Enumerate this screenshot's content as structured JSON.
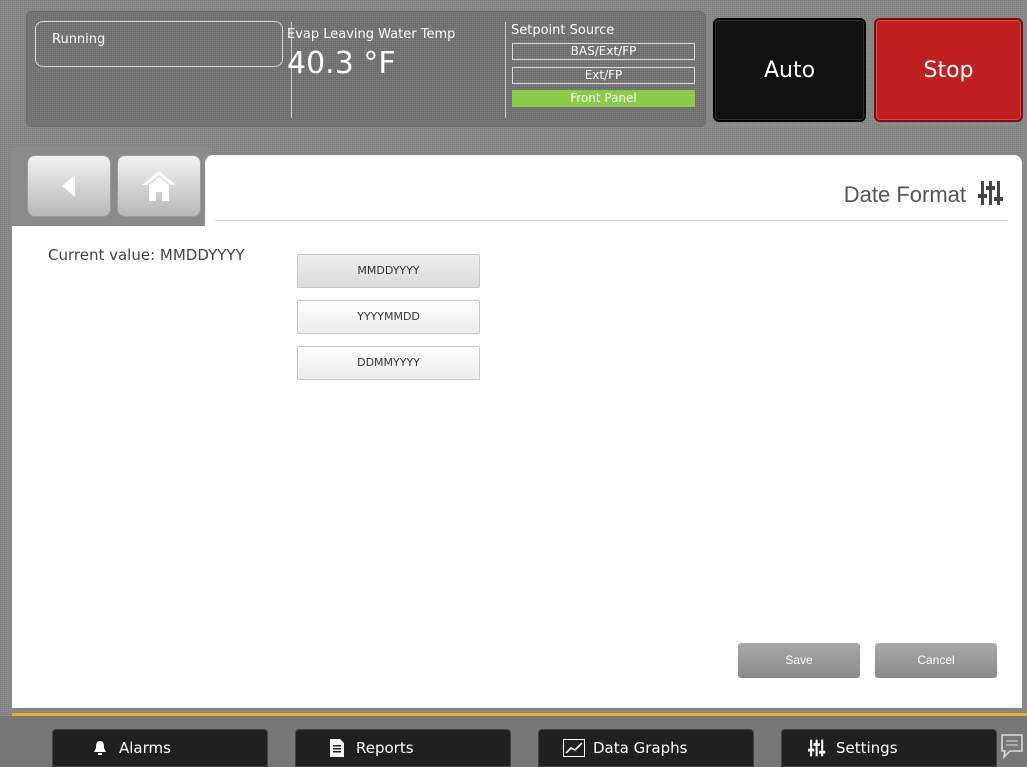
{
  "status": {
    "running": "Running",
    "evap_label": "Evap Leaving Water Temp",
    "evap_value": "40.3 °F",
    "setpoint_label": "Setpoint Source",
    "setpoint_options": [
      "BAS/Ext/FP",
      "Ext/FP",
      "Front Panel"
    ],
    "setpoint_active": "Front Panel",
    "active_color": "#8ccb4a"
  },
  "controls": {
    "auto": "Auto",
    "stop": "Stop",
    "stop_color": "#bf2121"
  },
  "page": {
    "title": "Date Format",
    "title_icon": "settings-sliders-icon",
    "current_value": "Current value: MMDDYYYY",
    "options": [
      "MMDDYYYY",
      "YYYYMMDD",
      "DDMMYYYY"
    ],
    "selected": "MMDDYYYY"
  },
  "actions": {
    "save": "Save",
    "cancel": "Cancel"
  },
  "nav": {
    "back_icon": "back-arrow-icon",
    "home_icon": "home-icon"
  },
  "bottom_nav": [
    {
      "label": "Alarms",
      "icon": "bell-icon"
    },
    {
      "label": "Reports",
      "icon": "document-icon"
    },
    {
      "label": "Data Graphs",
      "icon": "chart-icon"
    },
    {
      "label": "Settings",
      "icon": "settings-sliders-icon"
    }
  ],
  "accent_gold": "#e5b32b"
}
